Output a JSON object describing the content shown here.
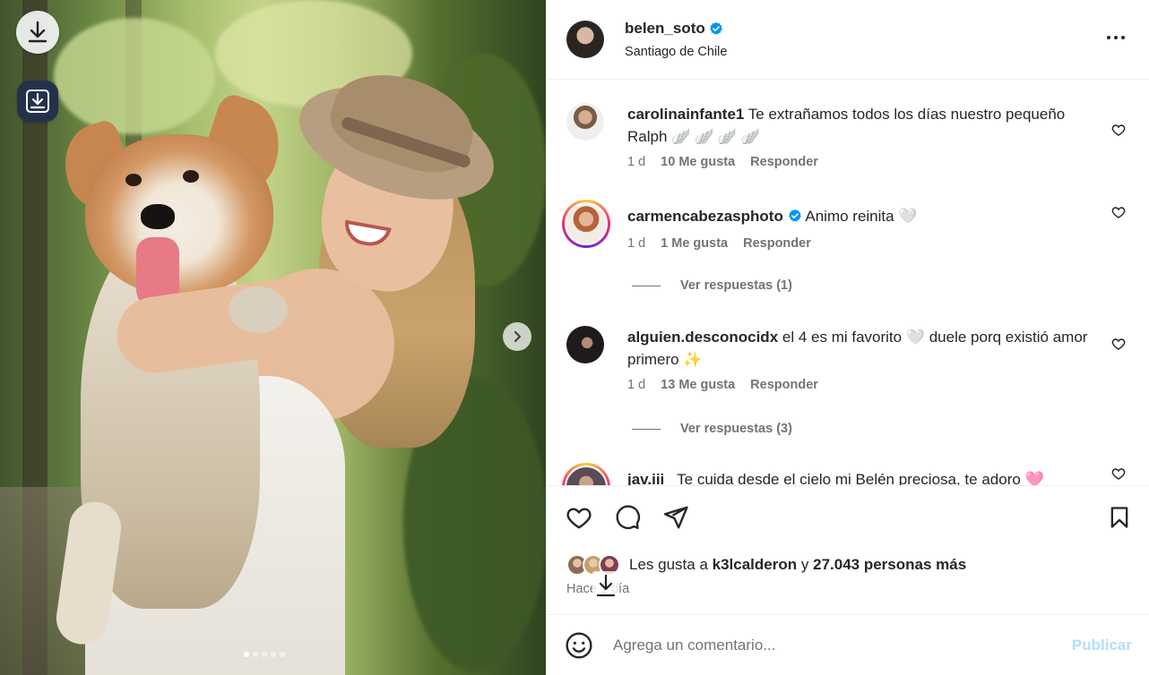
{
  "post": {
    "author": "belen_soto",
    "location": "Santiago de Chile",
    "image_count": 5,
    "active_image_index": 0
  },
  "comments": [
    {
      "user": "carolinainfante1",
      "text": "Te extrañamos todos los días nuestro pequeño Ralph 🪽 🪽 🪽 🪽",
      "time": "1 d",
      "likes": "10 Me gusta",
      "reply_label": "Responder"
    },
    {
      "user": "carmencabezasphoto",
      "verified": true,
      "text": "Animo reinita 🤍",
      "time": "1 d",
      "likes": "1 Me gusta",
      "reply_label": "Responder",
      "view_replies": "Ver respuestas (1)"
    },
    {
      "user": "alguien.desconocidx",
      "text": "el 4 es mi favorito 🤍 duele porq existió amor primero ✨",
      "time": "1 d",
      "likes": "13 Me gusta",
      "reply_label": "Responder",
      "view_replies": "Ver respuestas (3)"
    },
    {
      "user": "jav.iii",
      "text": "Te cuida desde el cielo mi Belén preciosa, te adoro 🩷"
    }
  ],
  "likes": {
    "prefix": "Les gusta a",
    "user": "k3lcalderon",
    "connector": "y",
    "others": "27.043 personas más"
  },
  "time_ago": "Hace 1 día",
  "comment_box": {
    "placeholder": "Agrega un comentario...",
    "publish_label": "Publicar"
  },
  "colors": {
    "verified": "#0095f6",
    "publish_disabled": "#b2dffc",
    "secondary_text": "#737373"
  }
}
